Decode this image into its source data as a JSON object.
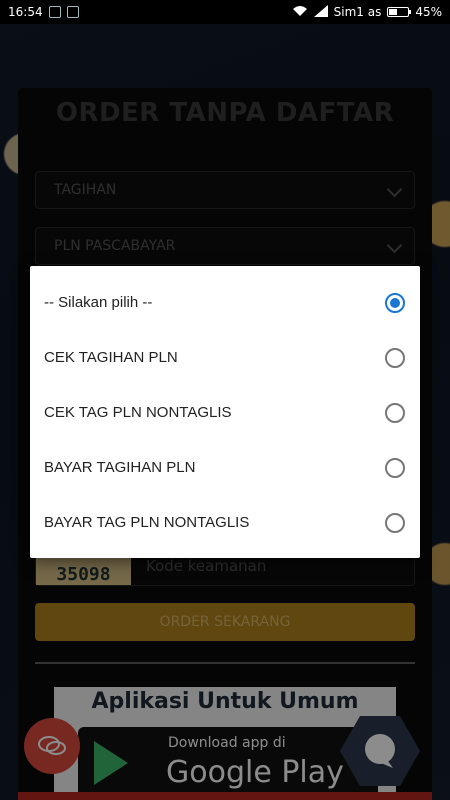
{
  "status_bar": {
    "time": "16:54",
    "carrier": "Sim1 as",
    "battery": "45%",
    "battery_level": 0.45
  },
  "page": {
    "title": "ORDER TANPA DAFTAR",
    "select_1": "TAGIHAN",
    "select_2": "PLN PASCABAYAR",
    "captcha_code": "35098",
    "captcha_placeholder": "Kode keamanan",
    "order_button": "ORDER SEKARANG",
    "promo_title": "Aplikasi Untuk Umum",
    "promo_download": "Download app di",
    "promo_store": "Google Play"
  },
  "dialog": {
    "options": [
      {
        "label": "-- Silakan pilih --",
        "selected": true
      },
      {
        "label": "CEK TAGIHAN PLN",
        "selected": false
      },
      {
        "label": "CEK TAG PLN NONTAGLIS",
        "selected": false
      },
      {
        "label": "BAYAR TAGIHAN PLN",
        "selected": false
      },
      {
        "label": "BAYAR TAG PLN NONTAGLIS",
        "selected": false
      }
    ]
  },
  "colors": {
    "accent": "#1976d2",
    "order_button": "#b0801c",
    "chat_fab": "#d9493b"
  }
}
